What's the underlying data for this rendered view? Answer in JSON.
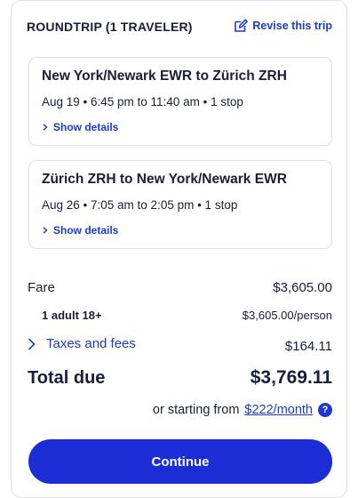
{
  "header": {
    "title": "ROUNDTRIP (1 TRAVELER)",
    "revise_label": "Revise this trip",
    "revise_icon": "edit-icon"
  },
  "flights": [
    {
      "route": "New York/Newark EWR to Zürich ZRH",
      "times": "Aug 19 • 6:45 pm to 11:40 am • 1 stop",
      "details_label": "Show details"
    },
    {
      "route": "Zürich ZRH to New York/Newark EWR",
      "times": "Aug 26 • 7:05 am to 2:05 pm • 1 stop",
      "details_label": "Show details"
    }
  ],
  "pricing": {
    "fare_label": "Fare",
    "fare_amount": "$3,605.00",
    "adult_label": "1 adult 18+",
    "adult_amount": "$3,605.00/person",
    "taxes_label": "Taxes and fees",
    "taxes_amount": "$164.11",
    "total_label": "Total due",
    "total_amount": "$3,769.11",
    "monthly_prefix": "or starting from",
    "monthly_link": "$222/month",
    "help_icon": "question-icon"
  },
  "actions": {
    "continue_label": "Continue"
  },
  "colors": {
    "accent": "#1b3ac9",
    "button": "#1b2dd4",
    "text": "#191e3b",
    "border": "#dfe0e4"
  }
}
